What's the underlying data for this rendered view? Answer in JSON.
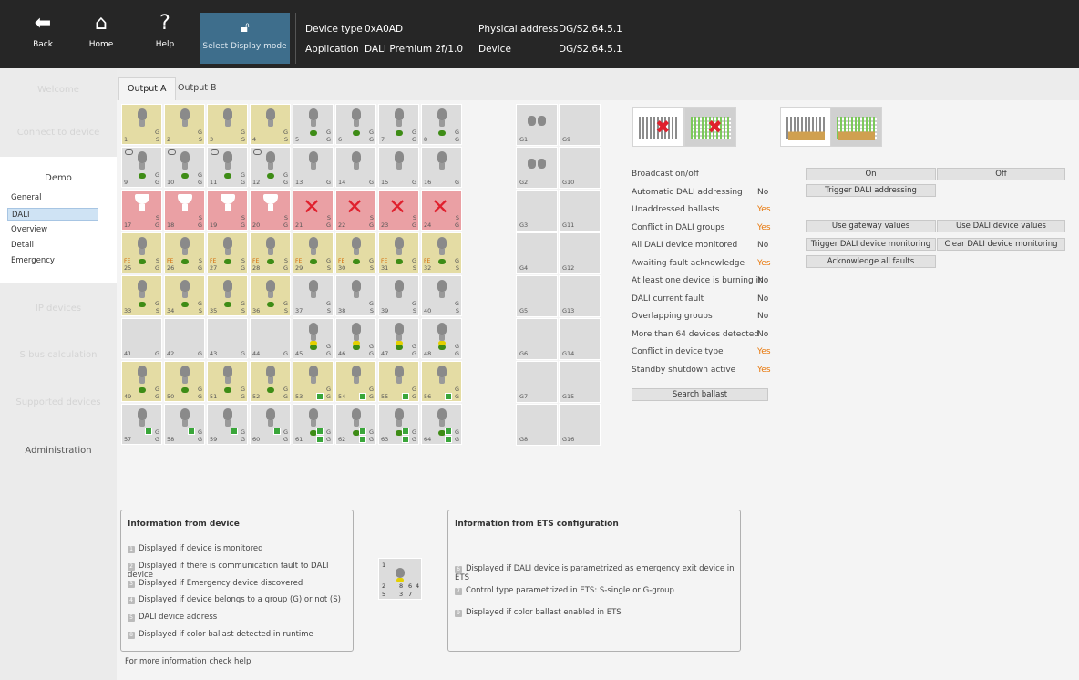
{
  "topbar": {
    "back": "Back",
    "home": "Home",
    "help": "Help",
    "help_icon": "?",
    "display_mode": "Select Display mode",
    "device_type_label": "Device type",
    "device_type_value": "0xA0AD",
    "application_label": "Application",
    "application_value": "DALI Premium 2f/1.0",
    "physical_address_label": "Physical address",
    "physical_address_value": "DG/S2.64.5.1",
    "device_label": "Device",
    "device_value": "DG/S2.64.5.1"
  },
  "sidebar": {
    "welcome": "Welcome",
    "connect": "Connect to device",
    "demo": "Demo",
    "sub_items": [
      "General",
      "DALI",
      "Overview",
      "Detail",
      "Emergency"
    ],
    "ip_devices": "IP devices",
    "sbus": "S bus calculation",
    "supported": "Supported devices",
    "administration": "Administration"
  },
  "tabs": [
    "Output A",
    "Output B"
  ],
  "groups": [
    "G1",
    "G9",
    "G2",
    "G10",
    "G3",
    "G11",
    "G4",
    "G12",
    "G5",
    "G13",
    "G6",
    "G14",
    "G7",
    "G15",
    "G8",
    "G16"
  ],
  "status": [
    {
      "label": "Broadcast on/off",
      "value": ""
    },
    {
      "label": "Automatic DALI addressing",
      "value": "No"
    },
    {
      "label": "Unaddressed ballasts",
      "value": "Yes"
    },
    {
      "label": "Conflict in DALI groups",
      "value": "Yes"
    },
    {
      "label": "All DALI device monitored",
      "value": "No"
    },
    {
      "label": "Awaiting fault acknowledge",
      "value": "Yes"
    },
    {
      "label": "At least one device is burning in",
      "value": "No"
    },
    {
      "label": "DALI current fault",
      "value": "No"
    },
    {
      "label": "Overlapping groups",
      "value": "No"
    },
    {
      "label": "More than 64 devices detected",
      "value": "No"
    },
    {
      "label": "Conflict in device type",
      "value": "Yes"
    },
    {
      "label": "Standby shutdown active",
      "value": "Yes"
    }
  ],
  "buttons": {
    "search_ballast": "Search ballast",
    "on": "On",
    "off": "Off",
    "trigger_addressing": "Trigger DALI addressing",
    "use_gateway": "Use gateway values",
    "use_device": "Use DALI device values",
    "trigger_monitoring": "Trigger DALI device monitoring",
    "clear_monitoring": "Clear DALI device monitoring",
    "ack_faults": "Acknowledge all faults"
  },
  "info_device": {
    "title": "Information from device",
    "lines": [
      {
        "n": "1",
        "t": "Displayed if device is monitored"
      },
      {
        "n": "2",
        "t": "Displayed if there is communication fault to DALI device"
      },
      {
        "n": "3",
        "t": "Displayed if Emergency device discovered"
      },
      {
        "n": "4",
        "t": "Displayed if device belongs to a group (G) or not (S)"
      },
      {
        "n": "5",
        "t": "DALI device address"
      },
      {
        "n": "8",
        "t": "Displayed if color ballast detected in runtime"
      }
    ]
  },
  "info_ets": {
    "title": "Information from ETS configuration",
    "lines": [
      {
        "n": "6",
        "t": "Displayed if DALI device is parametrized as emergency exit device in ETS"
      },
      {
        "n": "7",
        "t": "Control type parametrized in ETS: S-single or G-group"
      },
      {
        "n": "9",
        "t": "Displayed if color ballast enabled in ETS"
      }
    ]
  },
  "legend_cell": {
    "n1": "1",
    "n2": "2",
    "n3": "3",
    "n4": "4",
    "n5": "5",
    "n6": "6",
    "n7": "7",
    "n8": "8"
  },
  "footnote": "For more information check help",
  "devices": [
    {
      "a": "1",
      "t": "y",
      "g": "S",
      "g2": "G"
    },
    {
      "a": "2",
      "t": "y",
      "g": "S",
      "g2": "G"
    },
    {
      "a": "3",
      "t": "y",
      "g": "S",
      "g2": "G"
    },
    {
      "a": "4",
      "t": "y",
      "g": "S",
      "g2": "G"
    },
    {
      "a": "5",
      "t": "n",
      "g": "G",
      "g2": "G",
      "dot": 1
    },
    {
      "a": "6",
      "t": "n",
      "g": "G",
      "g2": "G",
      "dot": 1
    },
    {
      "a": "7",
      "t": "n",
      "g": "G",
      "g2": "G",
      "dot": 1
    },
    {
      "a": "8",
      "t": "n",
      "g": "G",
      "g2": "G",
      "dot": 1
    },
    {
      "a": "9",
      "t": "n",
      "g": "G",
      "g2": "G",
      "dot": 1,
      "ring": 1
    },
    {
      "a": "10",
      "t": "n",
      "g": "G",
      "g2": "G",
      "dot": 1,
      "ring": 1
    },
    {
      "a": "11",
      "t": "n",
      "g": "G",
      "g2": "G",
      "dot": 1,
      "ring": 1
    },
    {
      "a": "12",
      "t": "n",
      "g": "G",
      "g2": "G",
      "dot": 1,
      "ring": 1
    },
    {
      "a": "13",
      "t": "n",
      "g": "G"
    },
    {
      "a": "14",
      "t": "n",
      "g": "G"
    },
    {
      "a": "15",
      "t": "n",
      "g": "G"
    },
    {
      "a": "16",
      "t": "n",
      "g": "G"
    },
    {
      "a": "17",
      "t": "r",
      "g": "G",
      "g2": "S",
      "emg": 1
    },
    {
      "a": "18",
      "t": "r",
      "g": "G",
      "g2": "S",
      "emg": 1
    },
    {
      "a": "19",
      "t": "r",
      "g": "G",
      "g2": "S",
      "emg": 1
    },
    {
      "a": "20",
      "t": "r",
      "g": "G",
      "g2": "S",
      "emg": 1
    },
    {
      "a": "21",
      "t": "r",
      "g": "G",
      "g2": "S",
      "x": 1
    },
    {
      "a": "22",
      "t": "r",
      "g": "G",
      "g2": "S",
      "x": 1
    },
    {
      "a": "23",
      "t": "r",
      "g": "G",
      "g2": "S",
      "x": 1
    },
    {
      "a": "24",
      "t": "r",
      "g": "G",
      "g2": "S",
      "x": 1
    },
    {
      "a": "25",
      "t": "y",
      "g": "G",
      "g2": "S",
      "dot": 1,
      "fe": "FE"
    },
    {
      "a": "26",
      "t": "y",
      "g": "G",
      "g2": "S",
      "dot": 1,
      "fe": "FE"
    },
    {
      "a": "27",
      "t": "y",
      "g": "G",
      "g2": "S",
      "dot": 1,
      "fe": "FE"
    },
    {
      "a": "28",
      "t": "y",
      "g": "G",
      "g2": "S",
      "dot": 1,
      "fe": "FE"
    },
    {
      "a": "29",
      "t": "y",
      "g": "S",
      "g2": "G",
      "dot": 1,
      "fe": "FE"
    },
    {
      "a": "30",
      "t": "y",
      "g": "S",
      "g2": "G",
      "dot": 1,
      "fe": "FE"
    },
    {
      "a": "31",
      "t": "y",
      "g": "S",
      "g2": "G",
      "dot": 1,
      "fe": "FE"
    },
    {
      "a": "32",
      "t": "y",
      "g": "S",
      "g2": "G",
      "dot": 1,
      "fe": "FE"
    },
    {
      "a": "33",
      "t": "y",
      "g": "S",
      "g2": "G",
      "dot": 1
    },
    {
      "a": "34",
      "t": "y",
      "g": "S",
      "g2": "G",
      "dot": 1
    },
    {
      "a": "35",
      "t": "y",
      "g": "S",
      "g2": "G",
      "dot": 1
    },
    {
      "a": "36",
      "t": "y",
      "g": "S",
      "g2": "G",
      "dot": 1
    },
    {
      "a": "37",
      "t": "n",
      "g": "S",
      "g2": "G"
    },
    {
      "a": "38",
      "t": "n",
      "g": "S",
      "g2": "G"
    },
    {
      "a": "39",
      "t": "n",
      "g": "S",
      "g2": "G"
    },
    {
      "a": "40",
      "t": "n",
      "g": "S",
      "g2": "G"
    },
    {
      "a": "41",
      "t": "n",
      "g": "G",
      "empty": 1
    },
    {
      "a": "42",
      "t": "n",
      "g": "G",
      "empty": 1
    },
    {
      "a": "43",
      "t": "n",
      "g": "G",
      "empty": 1
    },
    {
      "a": "44",
      "t": "n",
      "g": "G",
      "empty": 1
    },
    {
      "a": "45",
      "t": "n",
      "g": "G",
      "g2": "G",
      "dot": 1,
      "yd": 1
    },
    {
      "a": "46",
      "t": "n",
      "g": "G",
      "g2": "G",
      "dot": 1,
      "yd": 1
    },
    {
      "a": "47",
      "t": "n",
      "g": "G",
      "g2": "G",
      "dot": 1,
      "yd": 1
    },
    {
      "a": "48",
      "t": "n",
      "g": "G",
      "g2": "G",
      "dot": 1,
      "yd": 1
    },
    {
      "a": "49",
      "t": "y",
      "g": "G",
      "g2": "G",
      "dot": 1
    },
    {
      "a": "50",
      "t": "y",
      "g": "G",
      "g2": "G",
      "dot": 1
    },
    {
      "a": "51",
      "t": "y",
      "g": "G",
      "g2": "G",
      "dot": 1
    },
    {
      "a": "52",
      "t": "y",
      "g": "G",
      "g2": "G",
      "dot": 1
    },
    {
      "a": "53",
      "t": "y",
      "g": "G",
      "g2": "G",
      "gb": 1
    },
    {
      "a": "54",
      "t": "y",
      "g": "G",
      "g2": "G",
      "gb": 1
    },
    {
      "a": "55",
      "t": "y",
      "g": "G",
      "g2": "G",
      "gb": 1
    },
    {
      "a": "56",
      "t": "y",
      "g": "G",
      "g2": "G",
      "gb": 1
    },
    {
      "a": "57",
      "t": "n",
      "g": "G",
      "g2": "G",
      "gb2": 1
    },
    {
      "a": "58",
      "t": "n",
      "g": "G",
      "g2": "G",
      "gb2": 1
    },
    {
      "a": "59",
      "t": "n",
      "g": "G",
      "g2": "G",
      "gb2": 1
    },
    {
      "a": "60",
      "t": "n",
      "g": "G",
      "g2": "G",
      "gb2": 1
    },
    {
      "a": "61",
      "t": "n",
      "g": "G",
      "g2": "G",
      "gb": 1,
      "gb2": 1,
      "dot": 1
    },
    {
      "a": "62",
      "t": "n",
      "g": "G",
      "g2": "G",
      "gb": 1,
      "gb2": 1,
      "dot": 1
    },
    {
      "a": "63",
      "t": "n",
      "g": "G",
      "g2": "G",
      "gb": 1,
      "gb2": 1,
      "dot": 1
    },
    {
      "a": "64",
      "t": "n",
      "g": "G",
      "g2": "G",
      "gb": 1,
      "gb2": 1,
      "dot": 1
    }
  ]
}
